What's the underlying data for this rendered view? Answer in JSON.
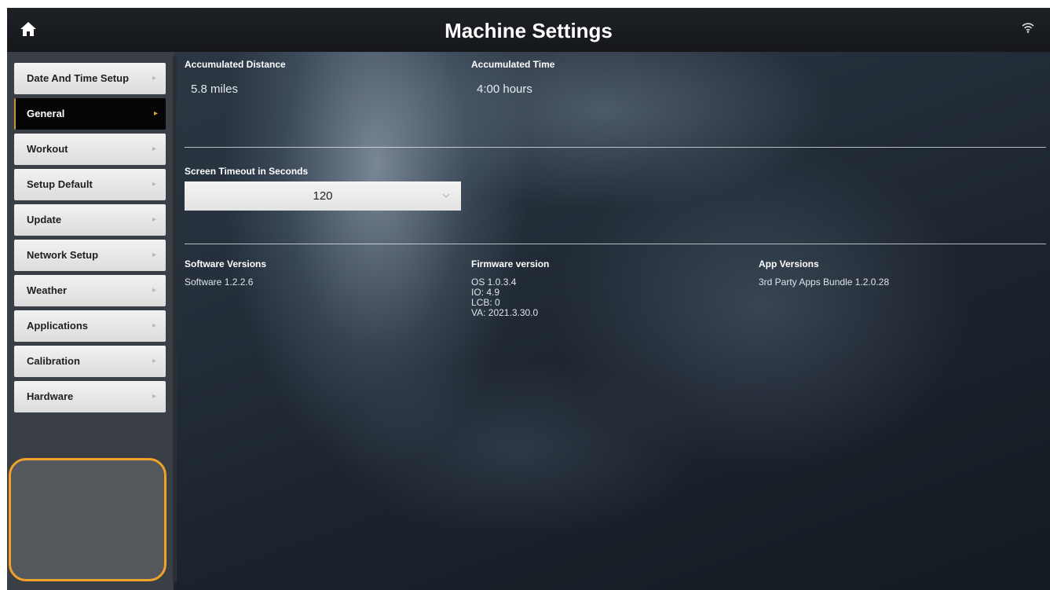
{
  "header": {
    "title": "Machine Settings",
    "home_icon": "home-icon",
    "wifi_icon": "wifi-icon"
  },
  "sidebar": {
    "items": [
      {
        "label": "Date And Time Setup"
      },
      {
        "label": "General",
        "active": true
      },
      {
        "label": "Workout"
      },
      {
        "label": "Setup Default"
      },
      {
        "label": "Update"
      },
      {
        "label": "Network Setup"
      },
      {
        "label": "Weather"
      },
      {
        "label": "Applications"
      },
      {
        "label": "Calibration"
      },
      {
        "label": "Hardware"
      }
    ],
    "chevron": "▸",
    "highlight_color": "#f0a22a",
    "active_accent_color": "#c8962d"
  },
  "general": {
    "accumulated_distance": {
      "label": "Accumulated Distance",
      "value": "5.8 miles"
    },
    "accumulated_time": {
      "label": "Accumulated Time",
      "value": "4:00 hours"
    },
    "screen_timeout": {
      "label": "Screen Timeout in Seconds",
      "selected": "120"
    },
    "software_versions": {
      "label": "Software Versions",
      "value": "Software 1.2.2.6"
    },
    "firmware_version": {
      "label": "Firmware version",
      "lines": [
        "OS 1.0.3.4",
        "IO: 4.9",
        "LCB:  0",
        "VA: 2021.3.30.0"
      ]
    },
    "app_versions": {
      "label": "App Versions",
      "value": "3rd Party Apps Bundle 1.2.0.28"
    }
  }
}
